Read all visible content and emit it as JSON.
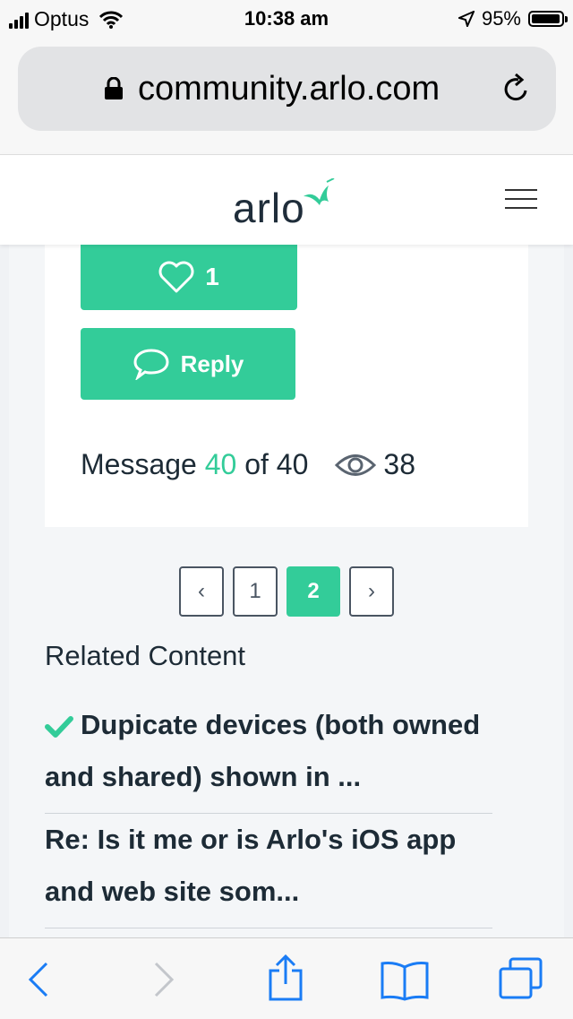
{
  "status_bar": {
    "carrier": "Optus",
    "time": "10:38 am",
    "battery": "95%"
  },
  "browser": {
    "url": "community.arlo.com"
  },
  "site": {
    "logo_text": "arlo"
  },
  "post": {
    "like_count": "1",
    "reply_label": "Reply",
    "message_prefix": "Message",
    "message_current": "40",
    "message_of": "of 40",
    "views": "38"
  },
  "pagination": {
    "prev": "‹",
    "pages": [
      "1",
      "2"
    ],
    "next": "›",
    "active_page": "2"
  },
  "related": {
    "title": "Related Content",
    "items": [
      {
        "text": "Dupicate devices (both owned and shared) shown in ...",
        "solved": true
      },
      {
        "text": "Re: Is it me or is Arlo's iOS app and web site som...",
        "solved": false
      }
    ]
  },
  "colors": {
    "accent": "#33cc99",
    "ios_blue": "#1a7cf5"
  }
}
